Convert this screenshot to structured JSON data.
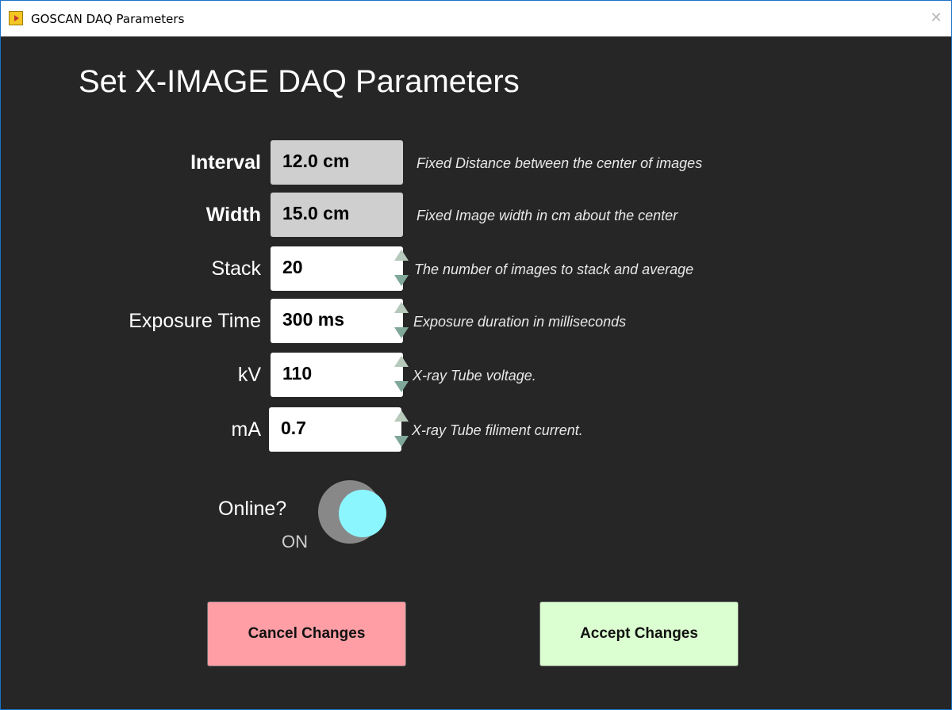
{
  "window": {
    "title": "GOSCAN DAQ Parameters"
  },
  "heading": "Set X-IMAGE DAQ Parameters",
  "fields": [
    {
      "label": "Interval",
      "value": "12.0 cm",
      "description": "Fixed Distance between the center of images",
      "editable": false
    },
    {
      "label": "Width",
      "value": "15.0 cm",
      "description": "Fixed Image width in cm about the center",
      "editable": false
    },
    {
      "label": "Stack",
      "value": "20",
      "description": "The number of images to stack and average",
      "editable": true
    },
    {
      "label": "Exposure Time",
      "value": "300 ms",
      "description": "Exposure duration in milliseconds",
      "editable": true
    },
    {
      "label": "kV",
      "value": "110",
      "description": "X-ray Tube voltage.",
      "editable": true
    },
    {
      "label": "mA",
      "value": "0.7",
      "description": "X-ray Tube filiment current.",
      "editable": true
    }
  ],
  "online": {
    "label": "Online?",
    "state": "ON"
  },
  "buttons": {
    "cancel": "Cancel Changes",
    "accept": "Accept Changes"
  },
  "colors": {
    "background": "#262626",
    "readonly_field": "#cfcfcf",
    "toggle_knob": "#8cf6ff",
    "cancel_button": "#ff9ea5",
    "accept_button": "#dbffd0"
  },
  "icons": {
    "app": "app-icon",
    "close": "close-icon",
    "spinner_up": "arrow-up-icon",
    "spinner_down": "arrow-down-icon"
  }
}
